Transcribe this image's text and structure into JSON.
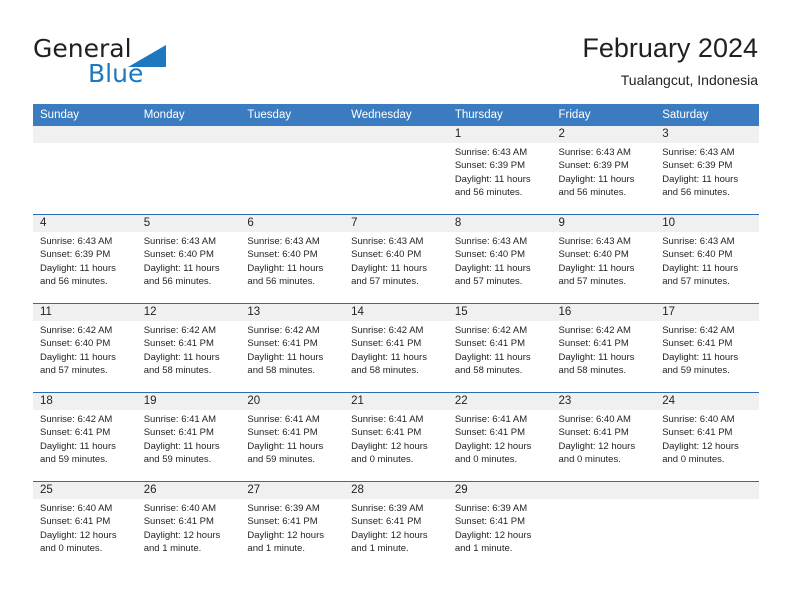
{
  "brand": {
    "name_top": "General",
    "name_bottom": "Blue",
    "triangle_icon": "triangle-icon",
    "colors": {
      "text": "#231f20",
      "accent": "#1e78bf"
    }
  },
  "header": {
    "title": "February 2024",
    "location": "Tualangcut, Indonesia"
  },
  "theme": {
    "header_bg": "#3a7cbf",
    "daynum_bg": "#f0f0f0",
    "row_divider": "#2a6db5",
    "text": "#231f20"
  },
  "weekdays": [
    "Sunday",
    "Monday",
    "Tuesday",
    "Wednesday",
    "Thursday",
    "Friday",
    "Saturday"
  ],
  "weeks": [
    [
      {
        "day": "",
        "lines": []
      },
      {
        "day": "",
        "lines": []
      },
      {
        "day": "",
        "lines": []
      },
      {
        "day": "",
        "lines": []
      },
      {
        "day": "1",
        "lines": [
          "Sunrise: 6:43 AM",
          "Sunset: 6:39 PM",
          "Daylight: 11 hours",
          "and 56 minutes."
        ]
      },
      {
        "day": "2",
        "lines": [
          "Sunrise: 6:43 AM",
          "Sunset: 6:39 PM",
          "Daylight: 11 hours",
          "and 56 minutes."
        ]
      },
      {
        "day": "3",
        "lines": [
          "Sunrise: 6:43 AM",
          "Sunset: 6:39 PM",
          "Daylight: 11 hours",
          "and 56 minutes."
        ]
      }
    ],
    [
      {
        "day": "4",
        "lines": [
          "Sunrise: 6:43 AM",
          "Sunset: 6:39 PM",
          "Daylight: 11 hours",
          "and 56 minutes."
        ]
      },
      {
        "day": "5",
        "lines": [
          "Sunrise: 6:43 AM",
          "Sunset: 6:40 PM",
          "Daylight: 11 hours",
          "and 56 minutes."
        ]
      },
      {
        "day": "6",
        "lines": [
          "Sunrise: 6:43 AM",
          "Sunset: 6:40 PM",
          "Daylight: 11 hours",
          "and 56 minutes."
        ]
      },
      {
        "day": "7",
        "lines": [
          "Sunrise: 6:43 AM",
          "Sunset: 6:40 PM",
          "Daylight: 11 hours",
          "and 57 minutes."
        ]
      },
      {
        "day": "8",
        "lines": [
          "Sunrise: 6:43 AM",
          "Sunset: 6:40 PM",
          "Daylight: 11 hours",
          "and 57 minutes."
        ]
      },
      {
        "day": "9",
        "lines": [
          "Sunrise: 6:43 AM",
          "Sunset: 6:40 PM",
          "Daylight: 11 hours",
          "and 57 minutes."
        ]
      },
      {
        "day": "10",
        "lines": [
          "Sunrise: 6:43 AM",
          "Sunset: 6:40 PM",
          "Daylight: 11 hours",
          "and 57 minutes."
        ]
      }
    ],
    [
      {
        "day": "11",
        "lines": [
          "Sunrise: 6:42 AM",
          "Sunset: 6:40 PM",
          "Daylight: 11 hours",
          "and 57 minutes."
        ]
      },
      {
        "day": "12",
        "lines": [
          "Sunrise: 6:42 AM",
          "Sunset: 6:41 PM",
          "Daylight: 11 hours",
          "and 58 minutes."
        ]
      },
      {
        "day": "13",
        "lines": [
          "Sunrise: 6:42 AM",
          "Sunset: 6:41 PM",
          "Daylight: 11 hours",
          "and 58 minutes."
        ]
      },
      {
        "day": "14",
        "lines": [
          "Sunrise: 6:42 AM",
          "Sunset: 6:41 PM",
          "Daylight: 11 hours",
          "and 58 minutes."
        ]
      },
      {
        "day": "15",
        "lines": [
          "Sunrise: 6:42 AM",
          "Sunset: 6:41 PM",
          "Daylight: 11 hours",
          "and 58 minutes."
        ]
      },
      {
        "day": "16",
        "lines": [
          "Sunrise: 6:42 AM",
          "Sunset: 6:41 PM",
          "Daylight: 11 hours",
          "and 58 minutes."
        ]
      },
      {
        "day": "17",
        "lines": [
          "Sunrise: 6:42 AM",
          "Sunset: 6:41 PM",
          "Daylight: 11 hours",
          "and 59 minutes."
        ]
      }
    ],
    [
      {
        "day": "18",
        "lines": [
          "Sunrise: 6:42 AM",
          "Sunset: 6:41 PM",
          "Daylight: 11 hours",
          "and 59 minutes."
        ]
      },
      {
        "day": "19",
        "lines": [
          "Sunrise: 6:41 AM",
          "Sunset: 6:41 PM",
          "Daylight: 11 hours",
          "and 59 minutes."
        ]
      },
      {
        "day": "20",
        "lines": [
          "Sunrise: 6:41 AM",
          "Sunset: 6:41 PM",
          "Daylight: 11 hours",
          "and 59 minutes."
        ]
      },
      {
        "day": "21",
        "lines": [
          "Sunrise: 6:41 AM",
          "Sunset: 6:41 PM",
          "Daylight: 12 hours",
          "and 0 minutes."
        ]
      },
      {
        "day": "22",
        "lines": [
          "Sunrise: 6:41 AM",
          "Sunset: 6:41 PM",
          "Daylight: 12 hours",
          "and 0 minutes."
        ]
      },
      {
        "day": "23",
        "lines": [
          "Sunrise: 6:40 AM",
          "Sunset: 6:41 PM",
          "Daylight: 12 hours",
          "and 0 minutes."
        ]
      },
      {
        "day": "24",
        "lines": [
          "Sunrise: 6:40 AM",
          "Sunset: 6:41 PM",
          "Daylight: 12 hours",
          "and 0 minutes."
        ]
      }
    ],
    [
      {
        "day": "25",
        "lines": [
          "Sunrise: 6:40 AM",
          "Sunset: 6:41 PM",
          "Daylight: 12 hours",
          "and 0 minutes."
        ]
      },
      {
        "day": "26",
        "lines": [
          "Sunrise: 6:40 AM",
          "Sunset: 6:41 PM",
          "Daylight: 12 hours",
          "and 1 minute."
        ]
      },
      {
        "day": "27",
        "lines": [
          "Sunrise: 6:39 AM",
          "Sunset: 6:41 PM",
          "Daylight: 12 hours",
          "and 1 minute."
        ]
      },
      {
        "day": "28",
        "lines": [
          "Sunrise: 6:39 AM",
          "Sunset: 6:41 PM",
          "Daylight: 12 hours",
          "and 1 minute."
        ]
      },
      {
        "day": "29",
        "lines": [
          "Sunrise: 6:39 AM",
          "Sunset: 6:41 PM",
          "Daylight: 12 hours",
          "and 1 minute."
        ]
      },
      {
        "day": "",
        "lines": []
      },
      {
        "day": "",
        "lines": []
      }
    ]
  ]
}
